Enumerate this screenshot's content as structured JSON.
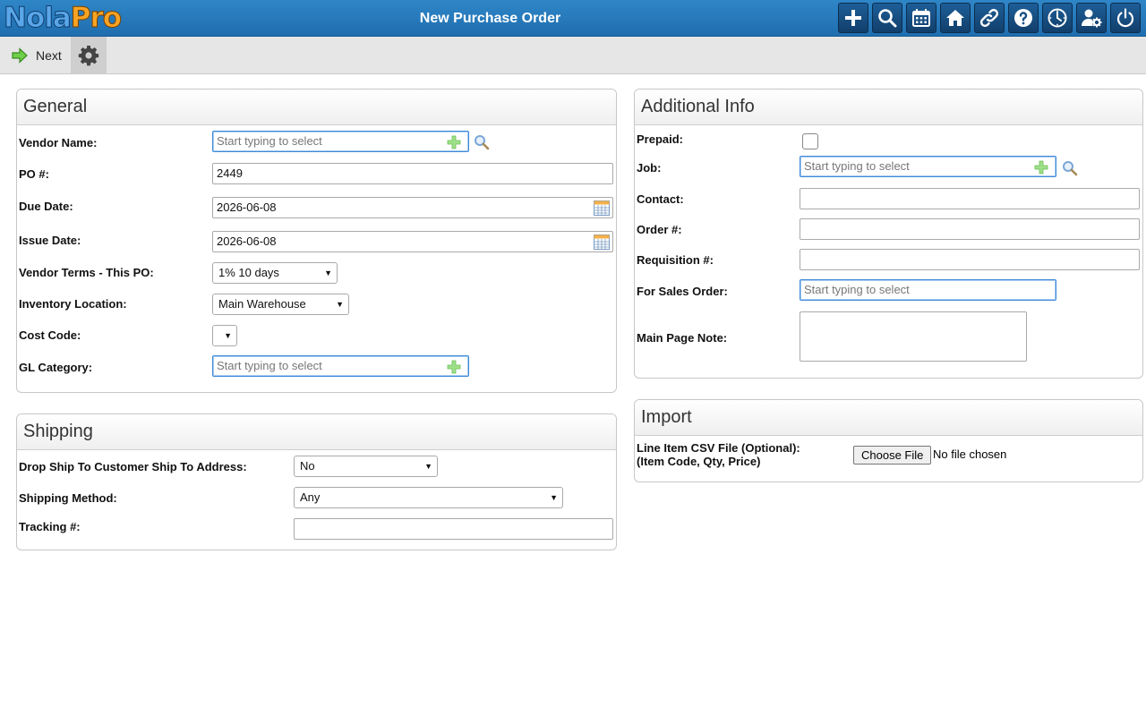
{
  "app": {
    "logo_part1": "Nola",
    "logo_part2": "Pro",
    "page_title": "New Purchase Order"
  },
  "top_icons": [
    {
      "name": "add-icon"
    },
    {
      "name": "search-icon"
    },
    {
      "name": "calendar-icon"
    },
    {
      "name": "home-icon"
    },
    {
      "name": "link-icon"
    },
    {
      "name": "help-icon"
    },
    {
      "name": "clock-icon"
    },
    {
      "name": "user-settings-icon"
    },
    {
      "name": "power-icon"
    }
  ],
  "toolbar": {
    "next_label": "Next"
  },
  "general": {
    "title": "General",
    "vendor_name": {
      "label": "Vendor Name:",
      "placeholder": "Start typing to select"
    },
    "po_number": {
      "label": "PO #:",
      "value": "2449"
    },
    "due_date": {
      "label": "Due Date:",
      "value": "2026-06-08"
    },
    "issue_date": {
      "label": "Issue Date:",
      "value": "2026-06-08"
    },
    "vendor_terms": {
      "label": "Vendor Terms - This PO:",
      "value": "1% 10 days"
    },
    "inventory_location": {
      "label": "Inventory Location:",
      "value": "Main Warehouse"
    },
    "cost_code": {
      "label": "Cost Code:",
      "value": ""
    },
    "gl_category": {
      "label": "GL Category:",
      "placeholder": "Start typing to select"
    }
  },
  "shipping": {
    "title": "Shipping",
    "drop_ship": {
      "label": "Drop Ship To Customer Ship To Address:",
      "value": "No"
    },
    "shipping_method": {
      "label": "Shipping Method:",
      "value": "Any"
    },
    "tracking": {
      "label": "Tracking #:",
      "value": ""
    }
  },
  "additional": {
    "title": "Additional Info",
    "prepaid": {
      "label": "Prepaid:"
    },
    "job": {
      "label": "Job:",
      "placeholder": "Start typing to select"
    },
    "contact": {
      "label": "Contact:",
      "value": ""
    },
    "order_number": {
      "label": "Order #:",
      "value": ""
    },
    "requisition": {
      "label": "Requisition #:",
      "value": ""
    },
    "for_sales_order": {
      "label": "For Sales Order:",
      "placeholder": "Start typing to select"
    },
    "main_page_note": {
      "label": "Main Page Note:"
    }
  },
  "import": {
    "title": "Import",
    "label_line1": "Line Item CSV File (Optional):",
    "label_line2": "(Item Code, Qty, Price)",
    "choose_file_label": "Choose File",
    "no_file_text": "No file chosen"
  }
}
